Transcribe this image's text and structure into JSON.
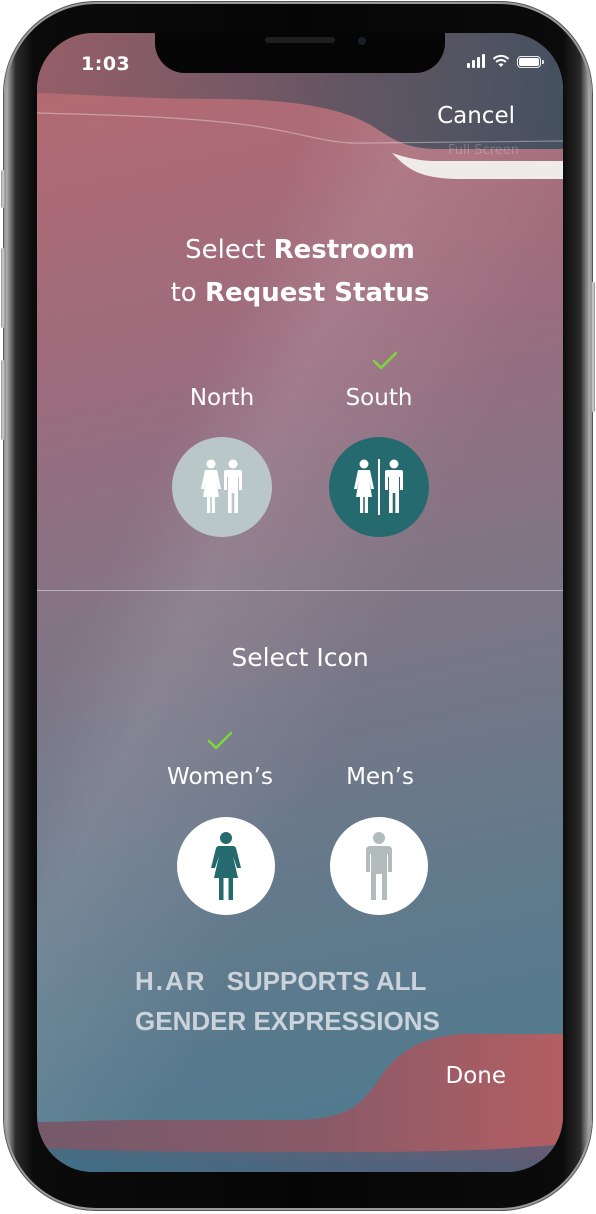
{
  "status_bar": {
    "time": "1:03"
  },
  "header": {
    "cancel_label": "Cancel",
    "ghost_label": "Full Screen"
  },
  "restroom_section": {
    "title_prefix": "Select ",
    "title_bold_1": "Restroom",
    "title_line2_prefix": "to ",
    "title_bold_2": "Request Status",
    "options": [
      {
        "label": "North",
        "selected": false,
        "icon": "unisex-restroom-icon"
      },
      {
        "label": "South",
        "selected": true,
        "icon": "unisex-restroom-divided-icon"
      }
    ]
  },
  "icon_section": {
    "title": "Select Icon",
    "options": [
      {
        "label": "Women’s",
        "selected": true,
        "icon": "woman-icon"
      },
      {
        "label": "Men’s",
        "selected": false,
        "icon": "man-icon"
      }
    ]
  },
  "footer": {
    "brand": "H.AR",
    "tagline_line1": "SUPPORTS ALL",
    "tagline_line2": "GENDER EXPRESSIONS",
    "done_label": "Done"
  },
  "colors": {
    "check_green": "#7fd63a",
    "teal": "#246a6e",
    "north_circle": "#b9c7c8",
    "men_figure": "#b3bcbc",
    "white": "#ffffff"
  }
}
